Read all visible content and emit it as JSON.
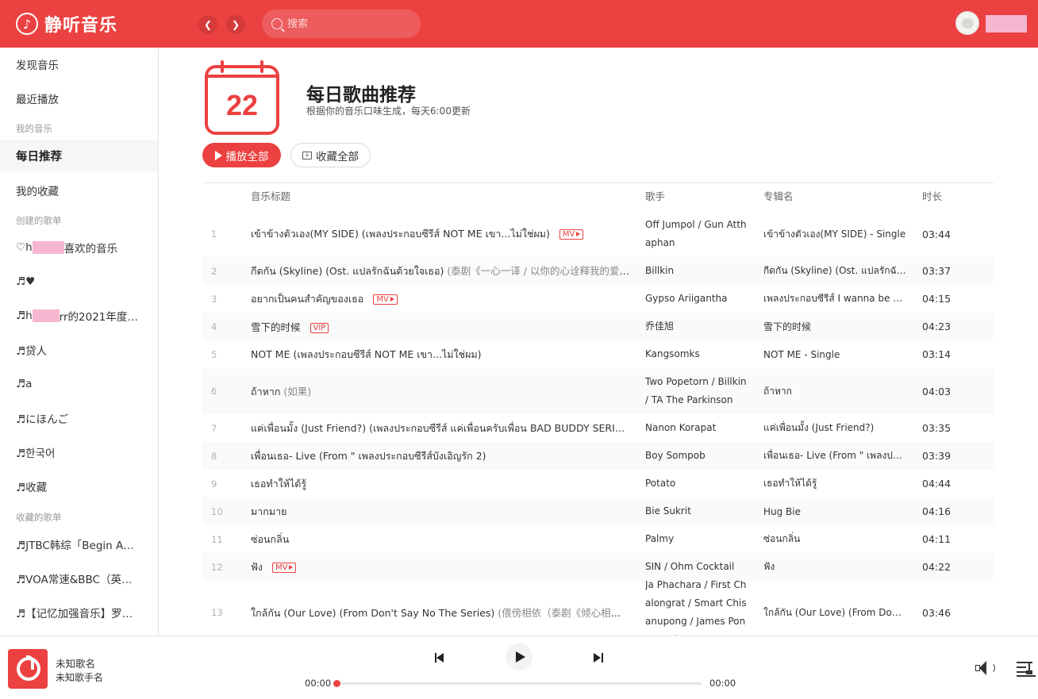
{
  "app": {
    "name": "静听音乐"
  },
  "search": {
    "placeholder": "搜索"
  },
  "sidebar": {
    "items": [
      {
        "label": "发现音乐"
      },
      {
        "label": "最近播放"
      }
    ],
    "section_my_music": "我的音乐",
    "daily": "每日推荐",
    "my_favorites": "我的收藏",
    "section_created": "创建的歌单",
    "created": [
      {
        "prefix": "♡h",
        "suffix": "喜欢的音乐",
        "masked": true
      },
      {
        "label": "♬♥"
      },
      {
        "prefix": "♬h",
        "suffix": "rr的2021年度…",
        "masked": true
      },
      {
        "label": "♬贷人"
      },
      {
        "label": "♬a"
      },
      {
        "label": "♬にほんご"
      },
      {
        "label": "♬한국어"
      },
      {
        "label": "♬收藏"
      }
    ],
    "section_collected": "收藏的歌单",
    "collected": [
      {
        "label": "♬JTBC韩综「Begin A…"
      },
      {
        "label": "♬VOA常速&BBC（英…"
      },
      {
        "label": "♬【记忆加强音乐】罗…"
      }
    ]
  },
  "header_page": {
    "calendar_day": "22",
    "title": "每日歌曲推荐",
    "subtitle": "根据你的音乐口味生成，每天6:00更新",
    "play_all": "播放全部",
    "collect_all": "收藏全部"
  },
  "table": {
    "columns": [
      "音乐标题",
      "歌手",
      "专辑名",
      "时长"
    ],
    "rows": [
      {
        "num": "1",
        "title": "เข้าข้างตัวเอง(MY SIDE) (เพลงประกอบซีรีส์ NOT ME เขา...ไม่ใช่ผม)",
        "alias": "",
        "badge": "MV",
        "artist": "Off Jumpol / Gun Atthaphan",
        "album": "เข้าข้างตัวเอง(MY SIDE) - Single",
        "duration": "03:44"
      },
      {
        "num": "2",
        "title": "กีดกัน (Skyline) (Ost. แปลรักฉันด้วยใจเธอ)",
        "alias": " (泰剧《一心一译 / 以你的心诠释我的爱》OST…",
        "badge": "",
        "artist": "Billkin",
        "album": "กีดกัน (Skyline) (Ost. แปลรักฉัน…",
        "duration": "03:37"
      },
      {
        "num": "3",
        "title": "อยากเป็นคนสำคัญของเธอ",
        "alias": "",
        "badge": "MV",
        "artist": "Gypso Ariigantha",
        "album": "เพลงประกอบซีรีส์ I wanna be su…",
        "duration": "04:15"
      },
      {
        "num": "4",
        "title": "雪下的时候",
        "alias": "",
        "badge": "VIP",
        "artist": "乔佳旭",
        "album": "雪下的时候",
        "duration": "04:23"
      },
      {
        "num": "5",
        "title": "NOT ME (เพลงประกอบซีรีส์ NOT ME เขา...ไม่ใช่ผม)",
        "alias": "",
        "badge": "",
        "artist": "Kangsomks",
        "album": "NOT ME - Single",
        "duration": "03:14"
      },
      {
        "num": "6",
        "title": "ถ้าหาก",
        "alias": " (如果)",
        "badge": "",
        "artist": "Two Popetorn / Billkin / TA The Parkinson",
        "album": "ถ้าหาก",
        "duration": "04:03"
      },
      {
        "num": "7",
        "title": "แค่เพื่อนมั้ง (Just Friend?) (เพลงประกอบซีรีส์ แค่เพื่อนครับเพื่อน BAD BUDDY SERIES) …",
        "alias": "",
        "badge": "",
        "artist": "Nanon Korapat",
        "album": "แค่เพื่อนมั้ง (Just Friend?)",
        "duration": "03:35"
      },
      {
        "num": "8",
        "title": "เพื่อนเธอ- Live (From \" เพลงประกอบซีรีส์บังเอิญรัก 2)",
        "alias": "",
        "badge": "",
        "artist": "Boy Sompob",
        "album": "เพื่อนเธอ- Live (From \" เพลงประ…",
        "duration": "03:39"
      },
      {
        "num": "9",
        "title": "เธอทำให้ได้รู้",
        "alias": "",
        "badge": "",
        "artist": "Potato",
        "album": "เธอทำให้ได้รู้",
        "duration": "04:44"
      },
      {
        "num": "10",
        "title": "มากมาย",
        "alias": "",
        "badge": "",
        "artist": "Bie Sukrit",
        "album": "Hug Bie",
        "duration": "04:16"
      },
      {
        "num": "11",
        "title": "ซ่อนกลิ่น",
        "alias": "",
        "badge": "",
        "artist": "Palmy",
        "album": "ซ่อนกลิ่น",
        "duration": "04:11"
      },
      {
        "num": "12",
        "title": "ฟัง",
        "alias": "",
        "badge": "MV",
        "artist": "SIN / Ohm Cocktail",
        "album": "ฟัง",
        "duration": "04:22"
      },
      {
        "num": "13",
        "title": "ใกล้กัน (Our Love) (From Don't Say No The Series)",
        "alias": " (偎傍相依（泰剧《倾心相印》片头…",
        "badge": "",
        "artist": "Ja Phachara / First Chalongrat / Smart Chisanupong / James Pongsapak",
        "album": "ใกล้กัน (Our Love) (From Don't …",
        "duration": "03:46"
      }
    ]
  },
  "player": {
    "song_name": "未知歌名",
    "artist_name": "未知歌手名",
    "current_time": "00:00",
    "total_time": "00:00",
    "progress": 0
  },
  "colors": {
    "accent": "#ec4141"
  }
}
